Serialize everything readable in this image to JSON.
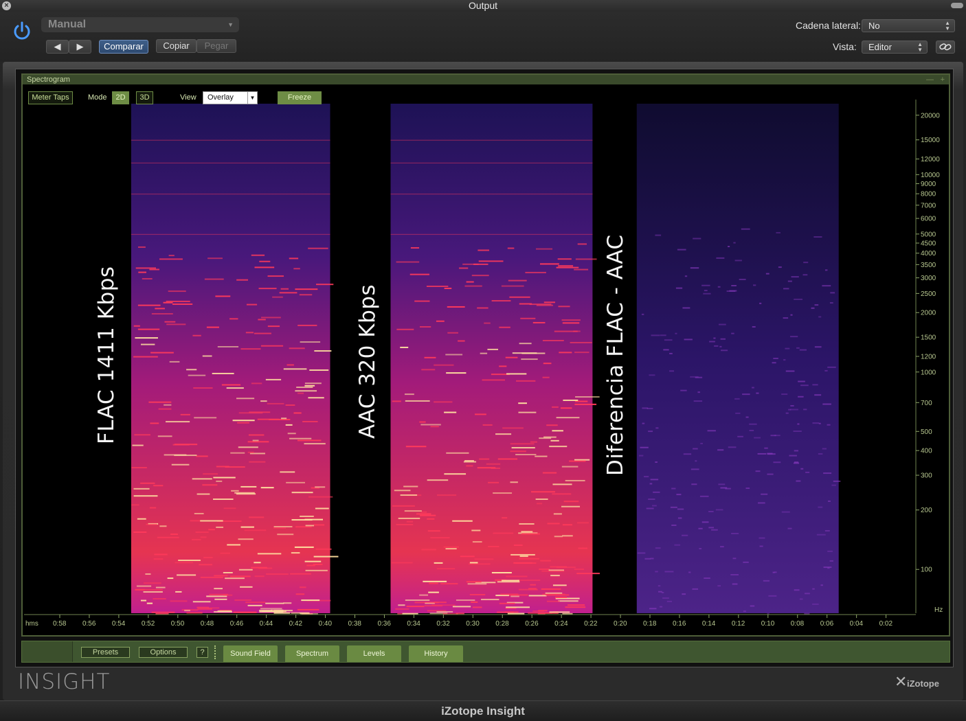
{
  "window": {
    "title": "Output"
  },
  "host": {
    "preset_value": "Manual",
    "prev_label": "◀",
    "next_label": "▶",
    "compare_label": "Comparar",
    "copy_label": "Copiar",
    "paste_label": "Pegar",
    "sidechain_label": "Cadena lateral:",
    "sidechain_value": "No",
    "view_label": "Vista:",
    "view_value": "Editor"
  },
  "spectrogram": {
    "panel_title": "Spectrogram",
    "meter_taps_label": "Meter Taps",
    "mode_label": "Mode",
    "mode_2d_label": "2D",
    "mode_3d_label": "3D",
    "view_label": "View",
    "view_value": "Overlay",
    "freeze_label": "Freeze",
    "freq_ticks": [
      20000,
      15000,
      12000,
      10000,
      9000,
      8000,
      7000,
      6000,
      5000,
      4500,
      4000,
      3500,
      3000,
      2500,
      2000,
      1500,
      1200,
      1000,
      700,
      500,
      400,
      300,
      200,
      100
    ],
    "freq_unit": "Hz",
    "time_origin_label": "hms",
    "time_ticks": [
      "0:58",
      "0:56",
      "0:54",
      "0:52",
      "0:50",
      "0:48",
      "0:46",
      "0:44",
      "0:42",
      "0:40",
      "0:38",
      "0:36",
      "0:34",
      "0:32",
      "0:30",
      "0:28",
      "0:26",
      "0:24",
      "0:22",
      "0:20",
      "0:18",
      "0:16",
      "0:14",
      "0:12",
      "0:10",
      "0:08",
      "0:06",
      "0:04",
      "0:02"
    ],
    "overlay_labels": {
      "flac": "FLAC 1411 Kbps",
      "aac": "AAC 320 Kbps",
      "diff": "Diferencia FLAC - AAC"
    },
    "colors": {
      "hot": "#ff3a5a",
      "mid": "#c0208f",
      "cool": "#2a1a7a",
      "bright": "#ffe0a0"
    }
  },
  "bottom": {
    "presets_label": "Presets",
    "options_label": "Options",
    "help_label": "?",
    "tabs": [
      "Sound Field",
      "Spectrum",
      "Levels",
      "History"
    ]
  },
  "brand": {
    "product": "INSIGHT",
    "vendor": "iZotope"
  },
  "footer": {
    "title": "iZotope Insight"
  }
}
